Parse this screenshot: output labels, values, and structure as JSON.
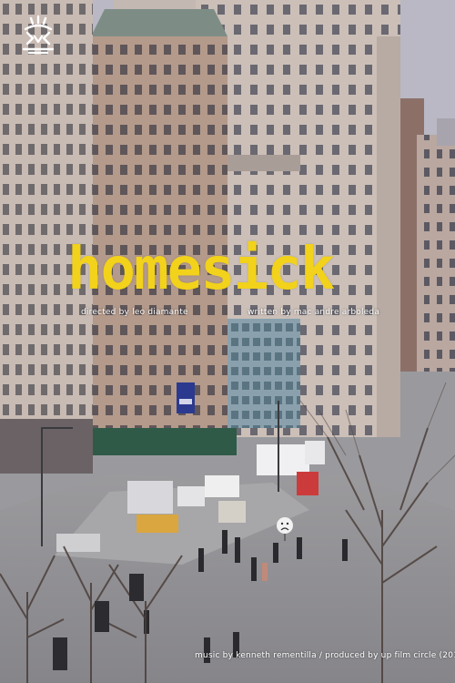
{
  "poster": {
    "title": "homesick",
    "directed_by": "directed  by leo diamante",
    "written_by": "written by mac andre arboleda",
    "bottom_credit": "music by kenneth rementilla / produced by up film circle (2018)"
  },
  "colors": {
    "title_yellow": "#f2d21a",
    "sky": "#b9b8c4",
    "building_left": "#c6b8b0",
    "building_center": "#b59c8e",
    "building_right": "#c9bcb4",
    "street": "#8f8e91",
    "banner": "#2b3a8f"
  },
  "icons": {
    "logo": "doodle-logo-icon",
    "sign": "sad-face-sign-icon"
  }
}
